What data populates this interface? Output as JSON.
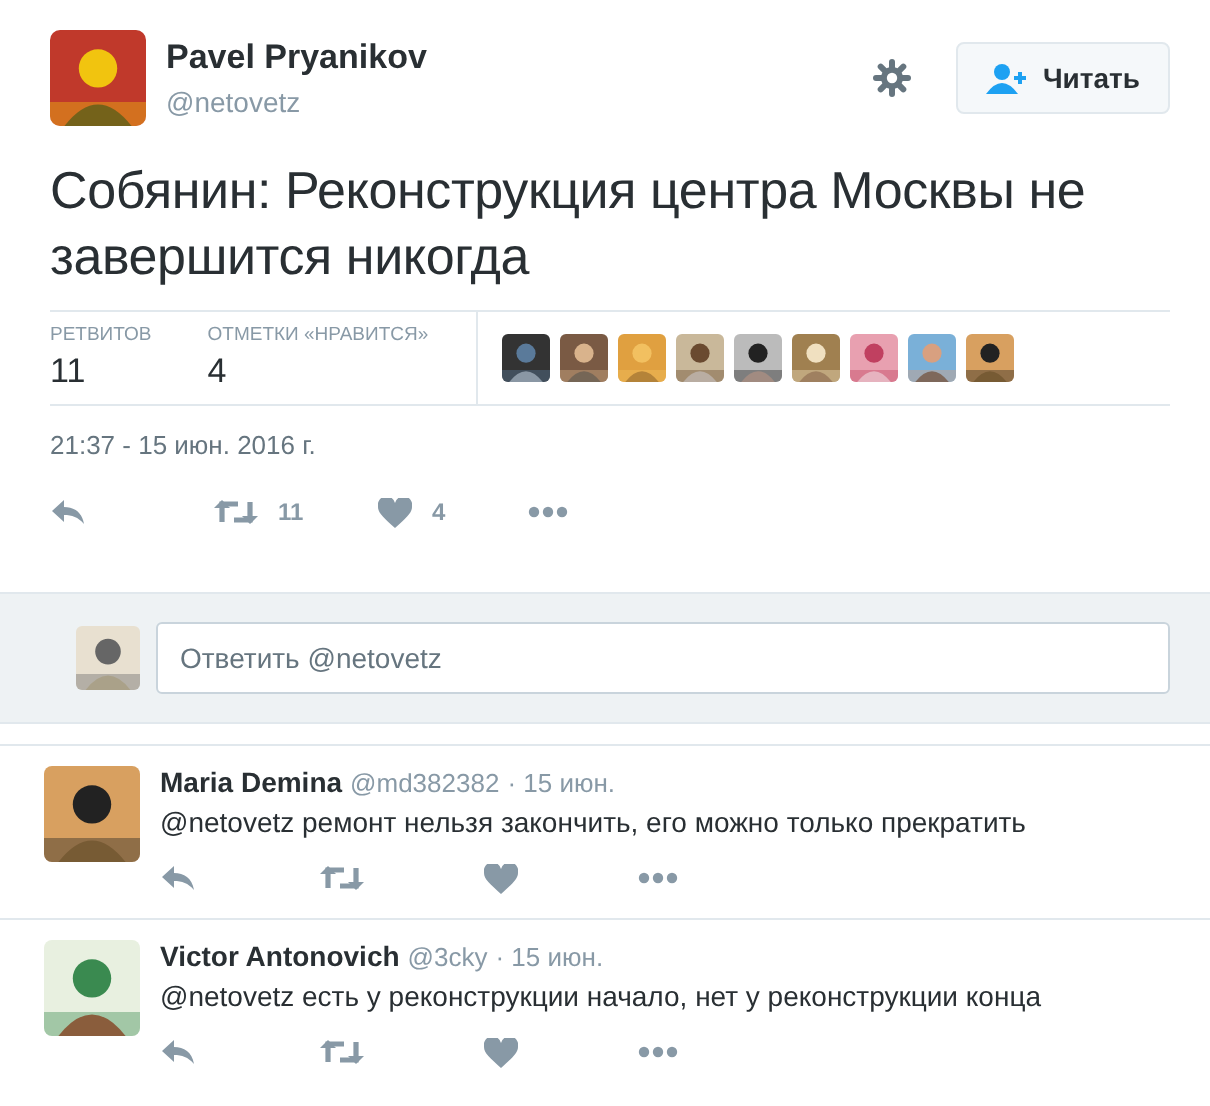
{
  "tweet": {
    "author": {
      "name": "Pavel Pryanikov",
      "handle": "@netovetz"
    },
    "follow_button": "Читать",
    "text": "Собянин: Реконструкция центра Москвы не завершится никогда",
    "stats": [
      {
        "label": "РЕТВИТОВ",
        "value": "11"
      },
      {
        "label": "ОТМЕТКИ «НРАВИТСЯ»",
        "value": "4"
      }
    ],
    "timestamp": "21:37 - 15 июн. 2016 г.",
    "actions": {
      "retweets": "11",
      "likes": "4"
    }
  },
  "reply_box": {
    "placeholder": "Ответить @netovetz"
  },
  "replies": [
    {
      "name": "Maria Demina",
      "handle": "@md382382",
      "date": "· 15 июн.",
      "text": "@netovetz ремонт нельзя закончить, его можно только прекратить"
    },
    {
      "name": "Victor Antonovich",
      "handle": "@3cky",
      "date": "· 15 июн.",
      "text": "@netovetz есть у реконструкции начало, нет у реконструкции конца"
    }
  ]
}
